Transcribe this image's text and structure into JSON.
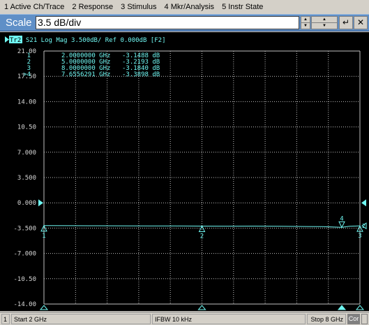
{
  "menu": {
    "items": [
      {
        "num": "1",
        "label": "Active Ch/Trace"
      },
      {
        "num": "2",
        "label": "Response"
      },
      {
        "num": "3",
        "label": "Stimulus"
      },
      {
        "num": "4",
        "label": "Mkr/Analysis"
      },
      {
        "num": "5",
        "label": "Instr State"
      }
    ]
  },
  "entry": {
    "label": "Scale",
    "value": "3.5 dB/div",
    "enter_icon": "enter-arrow-icon"
  },
  "trace_header": {
    "badge": "Tr2",
    "text": "S21  Log Mag 3.500dB/ Ref 0.000dB [F2]"
  },
  "markers": [
    {
      "id": "1",
      "prefix": "",
      "freq": "2.0000000 GHz",
      "value": "-3.1488 dB"
    },
    {
      "id": "2",
      "prefix": "",
      "freq": "5.0000000 GHz",
      "value": "-3.2193 dB"
    },
    {
      "id": "3",
      "prefix": "",
      "freq": "8.0000000 GHz",
      "value": "-3.1840 dB"
    },
    {
      "id": "4",
      "prefix": ">",
      "freq": "7.6556291 GHz",
      "value": "-3.3898 dB"
    }
  ],
  "colors": {
    "trace": "#6ff7f2",
    "grid": "#bfbfbf",
    "ylabels": "#d7d7d7",
    "background": "#000000",
    "entry_bar": "#5f8fc7"
  },
  "status": {
    "channel": "1",
    "start": "Start 2 GHz",
    "ifbw": "IFBW 10 kHz",
    "stop": "Stop 8 GHz",
    "cor": "Cor"
  },
  "chart_data": {
    "type": "line",
    "x_unit": "GHz",
    "xlim": [
      2,
      8
    ],
    "ylim": [
      -14,
      21
    ],
    "y_ticks": [
      "21.00",
      "17.50",
      "14.00",
      "10.50",
      "7.000",
      "3.500",
      "0.000",
      "-3.500",
      "-7.000",
      "-10.50",
      "-14.00"
    ],
    "reference": 0,
    "grid": true,
    "series": [
      {
        "x": [
          2.0,
          2.5,
          3.0,
          3.5,
          4.0,
          4.5,
          5.0,
          5.5,
          6.0,
          6.5,
          7.0,
          7.3,
          7.6556291,
          7.8,
          8.0
        ],
        "y": [
          -3.149,
          -3.16,
          -3.17,
          -3.18,
          -3.19,
          -3.2,
          -3.219,
          -3.23,
          -3.22,
          -3.24,
          -3.28,
          -3.3,
          -3.39,
          -3.25,
          -3.184
        ]
      }
    ],
    "marker_points": [
      {
        "id": "1",
        "x": 2.0,
        "y": -3.1488
      },
      {
        "id": "2",
        "x": 5.0,
        "y": -3.2193
      },
      {
        "id": "3",
        "x": 8.0,
        "y": -3.184
      },
      {
        "id": "4",
        "x": 7.6556291,
        "y": -3.3898
      }
    ]
  }
}
